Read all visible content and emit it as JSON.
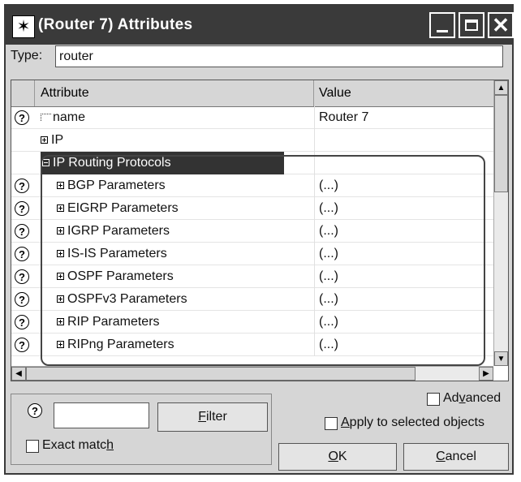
{
  "window": {
    "title": "(Router 7) Attributes",
    "app_icon": "star-burst-icon"
  },
  "type_field": {
    "label": "Type:",
    "value": "router"
  },
  "table": {
    "columns": [
      "Attribute",
      "Value"
    ],
    "rows": [
      {
        "attribute": "name",
        "value": "Router 7",
        "help": true,
        "kind": "leaf"
      },
      {
        "attribute": "IP",
        "value": "",
        "help": false,
        "kind": "expand"
      },
      {
        "attribute": "IP Routing Protocols",
        "value": "",
        "help": false,
        "kind": "collapse",
        "selected": true
      },
      {
        "attribute": "BGP Parameters",
        "value": "(...)",
        "help": true,
        "kind": "expand"
      },
      {
        "attribute": "EIGRP Parameters",
        "value": "(...)",
        "help": true,
        "kind": "expand"
      },
      {
        "attribute": "IGRP Parameters",
        "value": "(...)",
        "help": true,
        "kind": "expand"
      },
      {
        "attribute": "IS-IS Parameters",
        "value": "(...)",
        "help": true,
        "kind": "expand"
      },
      {
        "attribute": "OSPF Parameters",
        "value": "(...)",
        "help": true,
        "kind": "expand"
      },
      {
        "attribute": "OSPFv3 Parameters",
        "value": "(...)",
        "help": true,
        "kind": "expand"
      },
      {
        "attribute": "RIP Parameters",
        "value": "(...)",
        "help": true,
        "kind": "expand"
      },
      {
        "attribute": "RIPng Parameters",
        "value": "(...)",
        "help": true,
        "kind": "expand"
      }
    ]
  },
  "help_glyph": "?",
  "filter": {
    "input_value": "",
    "button_label_first": "F",
    "button_label_rest": "ilter",
    "exact_match_label_main": "Exact matc",
    "exact_match_label_underlined": "h"
  },
  "options": {
    "advanced_main": "Ad",
    "advanced_underlined": "v",
    "advanced_rest": "anced",
    "apply_underlined": "A",
    "apply_rest": "pply to selected objects"
  },
  "buttons": {
    "ok_underlined": "O",
    "ok_rest": "K",
    "cancel_underlined": "C",
    "cancel_rest": "ancel"
  }
}
